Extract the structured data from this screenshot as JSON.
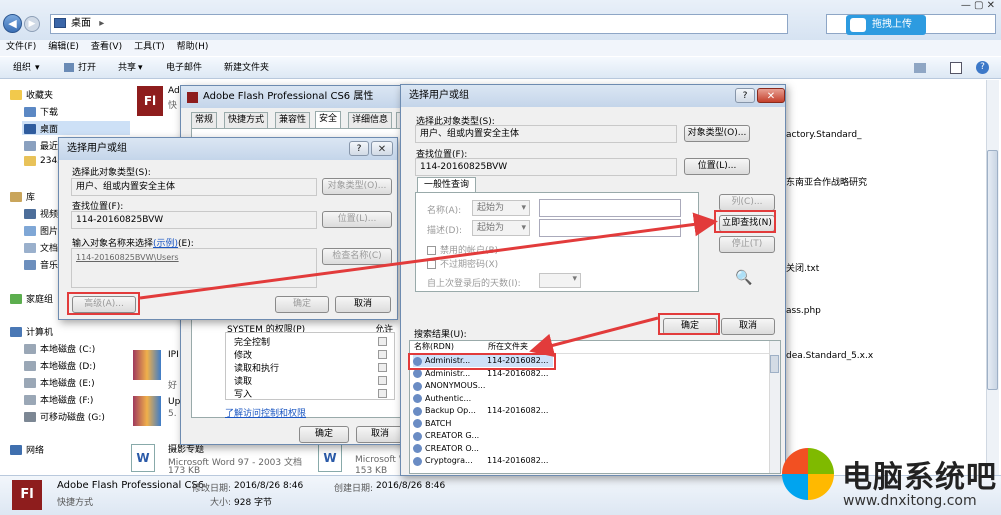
{
  "explorer": {
    "address_label": "桌面",
    "menu": [
      "文件(F)",
      "编辑(E)",
      "查看(V)",
      "工具(T)",
      "帮助(H)"
    ],
    "toolbar": [
      "组织",
      "打开",
      "共享",
      "电子邮件",
      "新建文件夹"
    ],
    "upload_label": "拖拽上传",
    "nav": [
      "收藏夹",
      "下载",
      "桌面",
      "最近",
      "2345",
      "库",
      "视频",
      "图片",
      "文档",
      "音乐",
      "家庭组",
      "计算机",
      "本地磁盘 (C:)",
      "本地磁盘 (D:)",
      "本地磁盘 (E:)",
      "本地磁盘 (F:)",
      "可移动磁盘 (G:)",
      "网络"
    ],
    "right_texts": [
      "actory.Standard_",
      "东南亚合作战略研究",
      "关闭.txt",
      "ass.php",
      "dea.Standard_5.x.x"
    ],
    "file_items": [
      {
        "name": "Ad",
        "sub": "快"
      },
      {
        "name": "IPI",
        "sub": "好"
      },
      {
        "name": "Up",
        "sub": "5."
      },
      {
        "name": "摄影专题",
        "sub": "Microsoft Word 97 - 2003 文档",
        "size": "173 KB"
      },
      {
        "name": "Microsoft W",
        "sub": "153 KB"
      }
    ],
    "status": {
      "name": "Adobe Flash Professional CS6",
      "type": "快捷方式",
      "modified_label": "修改日期:",
      "modified": "2016/8/26 8:46",
      "created_label": "创建日期:",
      "created": "2016/8/26 8:46",
      "size_label": "大小:",
      "size": "928 字节"
    }
  },
  "props": {
    "title": "Adobe Flash Professional CS6 属性",
    "tabs": [
      "常规",
      "快捷方式",
      "兼容性",
      "安全",
      "详细信息",
      "以前"
    ],
    "perm_header": "SYSTEM 的权限(P)",
    "perm_allow": "允许",
    "perms": [
      "完全控制",
      "修改",
      "读取和执行",
      "读取",
      "写入"
    ],
    "link": "了解访问控制和权限",
    "ok": "确定",
    "cancel": "取消"
  },
  "small": {
    "title": "选择用户或组",
    "type_label": "选择此对象类型(S):",
    "type_value": "用户、组或内置安全主体",
    "type_btn": "对象类型(O)...",
    "loc_label": "查找位置(F):",
    "loc_value": "114-20160825BVW",
    "loc_btn": "位置(L)...",
    "name_label": "输入对象名称来选择",
    "name_link": "(示例)",
    "name_label_end": "(E):",
    "name_value": "114-20160825BVW\\Users",
    "check_btn": "检查名称(C)",
    "adv_btn": "高级(A)...",
    "ok": "确定",
    "cancel": "取消"
  },
  "big": {
    "title": "选择用户或组",
    "type_label": "选择此对象类型(S):",
    "type_value": "用户、组或内置安全主体",
    "type_btn": "对象类型(O)...",
    "loc_label": "查找位置(F):",
    "loc_value": "114-20160825BVW",
    "loc_btn": "位置(L)...",
    "tab": "一般性查询",
    "name_label": "名称(A):",
    "desc_label": "描述(D):",
    "starts": "起始为",
    "col_btn": "列(C)...",
    "find_btn": "立即查找(N)",
    "stop_btn": "停止(T)",
    "disabled": "禁用的帐户(B)",
    "noexpire": "不过期密码(X)",
    "days_label": "自上次登录后的天数(I):",
    "ok": "确定",
    "cancel": "取消",
    "results_label": "搜索结果(U):",
    "col_name": "名称(RDN)",
    "col_folder": "所在文件夹",
    "results": [
      {
        "name": "Administr...",
        "folder": "114-2016082..."
      },
      {
        "name": "Administr...",
        "folder": "114-2016082..."
      },
      {
        "name": "ANONYMOUS...",
        "folder": ""
      },
      {
        "name": "Authentic...",
        "folder": ""
      },
      {
        "name": "Backup Op...",
        "folder": "114-2016082..."
      },
      {
        "name": "BATCH",
        "folder": ""
      },
      {
        "name": "CREATOR G...",
        "folder": ""
      },
      {
        "name": "CREATOR O...",
        "folder": ""
      },
      {
        "name": "Cryptogra...",
        "folder": "114-2016082..."
      }
    ]
  },
  "watermark": {
    "brand": "电脑系统吧",
    "url": "www.dnxitong.com"
  },
  "colors": {
    "highlight": "#e23b3b",
    "accent": "#3a78c8"
  }
}
